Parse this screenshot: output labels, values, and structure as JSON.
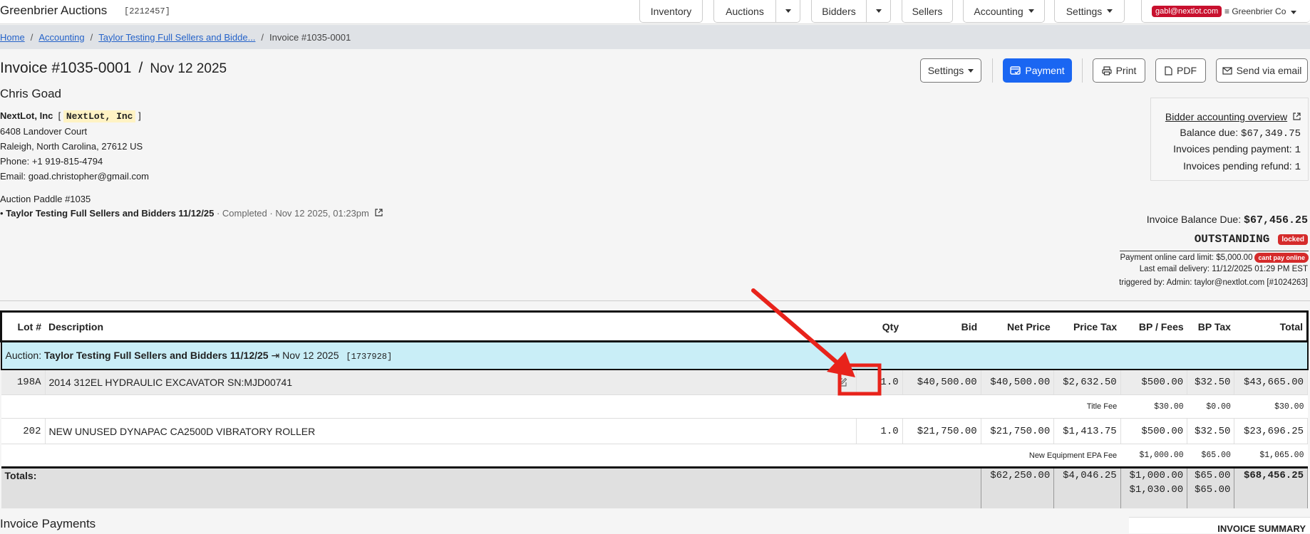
{
  "app": {
    "title": "Greenbrier Auctions",
    "account_id": "[2212457]"
  },
  "nav": {
    "inventory": "Inventory",
    "auctions": "Auctions",
    "bidders": "Bidders",
    "sellers": "Sellers",
    "accounting": "Accounting",
    "settings": "Settings",
    "user_email": "gabl@nextlot.com",
    "company": "≡ Greenbrier Co"
  },
  "breadcrumb": {
    "home": "Home",
    "accounting": "Accounting",
    "auction": "Taylor Testing Full Sellers and Bidde...",
    "current": "Invoice #1035-0001"
  },
  "invoice": {
    "number": "Invoice #1035-0001",
    "date": "Nov 12 2025",
    "customer": "Chris Goad",
    "company": "NextLot, Inc",
    "company_tag": "NextLot, Inc",
    "address1": "6408 Landover Court",
    "address2": "Raleigh, North Carolina, 27612 US",
    "phone": "Phone: +1 919-815-4794",
    "email": "Email: goad.christopher@gmail.com",
    "paddle": "Auction Paddle #1035",
    "auction_name": "Taylor Testing Full Sellers and Bidders 11/12/25",
    "auction_status": "· Completed · Nov 12 2025, 01:23pm"
  },
  "actions": {
    "settings": "Settings",
    "payment": "Payment",
    "print": "Print",
    "pdf": "PDF",
    "send_email": "Send via email"
  },
  "overview": {
    "link": "Bidder accounting overview",
    "balance_label": "Balance due:",
    "balance_value": "$67,349.75",
    "pending_payment_label": "Invoices pending payment:",
    "pending_payment_value": "1",
    "pending_refund_label": "Invoices pending refund:",
    "pending_refund_value": "1"
  },
  "status": {
    "balance_label": "Invoice Balance Due:",
    "balance_value": "$67,456.25",
    "state": "OUTSTANDING",
    "locked": "locked",
    "card_limit": "Payment online card limit: $5,000.00",
    "cant_pay": "cant pay online",
    "last_email": "Last email delivery: 11/12/2025 01:29 PM EST",
    "triggered": "triggered by: Admin: taylor@nextlot.com [#1024263]"
  },
  "table": {
    "headers": {
      "lot": "Lot #",
      "desc": "Description",
      "qty": "Qty",
      "bid": "Bid",
      "net": "Net Price",
      "price_tax": "Price Tax",
      "bp_fees": "BP / Fees",
      "bp_tax": "BP Tax",
      "total": "Total"
    },
    "auction_label": "Auction:",
    "auction_name": "Taylor Testing Full Sellers and Bidders 11/12/25",
    "auction_date": "⇥ Nov 12 2025",
    "auction_id": "[1737928]",
    "rows": [
      {
        "lot": "198A",
        "desc": "2014 312EL HYDRAULIC EXCAVATOR SN:MJD00741",
        "qty": "1.0",
        "bid": "$40,500.00",
        "net": "$40,500.00",
        "price_tax": "$2,632.50",
        "bp_fees": "$500.00",
        "bp_tax": "$32.50",
        "total": "$43,665.00",
        "fee": {
          "label": "Title Fee",
          "bp_fees": "$30.00",
          "bp_tax": "$0.00",
          "total": "$30.00"
        }
      },
      {
        "lot": "202",
        "desc": "NEW UNUSED DYNAPAC CA2500D VIBRATORY ROLLER",
        "qty": "1.0",
        "bid": "$21,750.00",
        "net": "$21,750.00",
        "price_tax": "$1,413.75",
        "bp_fees": "$500.00",
        "bp_tax": "$32.50",
        "total": "$23,696.25",
        "fee": {
          "label": "New Equipment EPA Fee",
          "bp_fees": "$1,000.00",
          "bp_tax": "$65.00",
          "total": "$1,065.00"
        }
      }
    ],
    "totals": {
      "label": "Totals:",
      "net": "$62,250.00",
      "price_tax": "$4,046.25",
      "bp_fees_1": "$1,000.00",
      "bp_fees_2": "$1,030.00",
      "bp_tax_1": "$65.00",
      "bp_tax_2": "$65.00",
      "total": "$68,456.25"
    }
  },
  "footer": {
    "payments": "Invoice Payments",
    "summary": "INVOICE SUMMARY"
  },
  "colors": {
    "primary": "#1a66f2",
    "danger": "#d52b2b",
    "annotation": "#e8231b",
    "auction_row": "#c9eef7"
  }
}
